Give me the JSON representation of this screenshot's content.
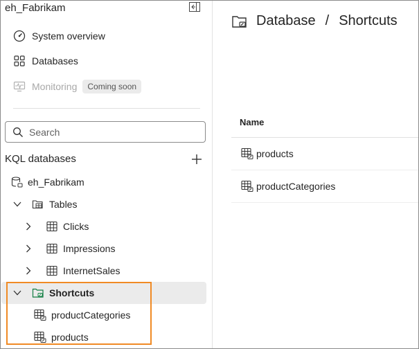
{
  "workspace": {
    "title": "eh_Fabrikam"
  },
  "nav": {
    "system_overview": "System overview",
    "databases": "Databases",
    "monitoring": "Monitoring",
    "monitoring_badge": "Coming soon"
  },
  "search": {
    "placeholder": "Search"
  },
  "kql": {
    "section_label": "KQL databases",
    "database": "eh_Fabrikam",
    "tables_label": "Tables",
    "tables": [
      "Clicks",
      "Impressions",
      "InternetSales"
    ],
    "shortcuts_label": "Shortcuts",
    "shortcuts": [
      "productCategories",
      "products"
    ]
  },
  "breadcrumb": {
    "root": "Database",
    "separator": "/",
    "current": "Shortcuts"
  },
  "table": {
    "header_name": "Name",
    "rows": [
      "products",
      "productCategories"
    ]
  },
  "colors": {
    "highlight": "#f08a24",
    "selected_bg": "#ebebeb",
    "shortcut_icon": "#107c41"
  },
  "icons": {
    "collapse": "panel-collapse-icon",
    "system_overview": "gauge-icon",
    "databases": "grid-icon",
    "monitoring": "monitor-icon",
    "search": "search-icon",
    "add": "plus-icon",
    "database": "database-icon",
    "tables": "tables-folder-icon",
    "table": "table-icon",
    "shortcut_folder": "shortcut-folder-icon",
    "shortcut_table": "shortcut-table-icon"
  }
}
